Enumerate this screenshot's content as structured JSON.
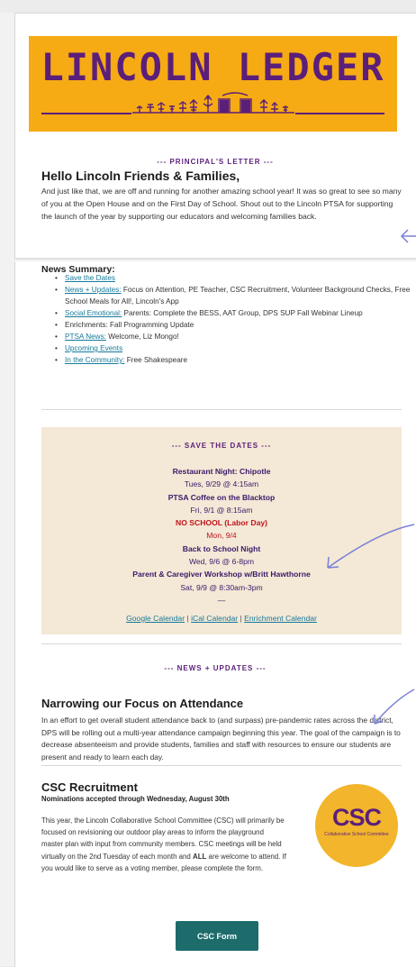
{
  "banner": {
    "title": "LINCOLN LEDGER"
  },
  "principal": {
    "section_label": "--- PRINCIPAL'S LETTER ---",
    "greeting": "Hello Lincoln Friends & Families,",
    "body": "And just like that, we are off and running for another amazing school year! It was so great to see so many of you at the Open House and on the First Day of School. Shout out to the Lincoln PTSA for supporting the launch of the year by supporting our educators and welcoming families back."
  },
  "summary": {
    "title": "News Summary:",
    "items": [
      {
        "link": "Save the Dates",
        "text": ""
      },
      {
        "link": "News + Updates:",
        "text": " Focus on Attention, PE Teacher, CSC Recruitment, Volunteer Background Checks, Free School Meals for All!, Lincoln's App"
      },
      {
        "link": "Social Emotional:",
        "text": " Parents: Complete the BESS, AAT Group, DPS SUP Fall Webinar Lineup"
      },
      {
        "link": "",
        "text": "Enrichments: Fall Programming Update"
      },
      {
        "link": "PTSA News:",
        "text": " Welcome, Liz Mongo!"
      },
      {
        "link": "Upcoming Events",
        "text": ""
      },
      {
        "link": "In the Community:",
        "text": " Free Shakespeare"
      }
    ]
  },
  "save_dates": {
    "section_label": "--- SAVE THE DATES ---",
    "events": [
      {
        "title": "Restaurant Night: Chipotle",
        "date": "Tues, 9/29 @ 4:15am"
      },
      {
        "title": "PTSA Coffee on the Blacktop",
        "date": "Fri, 9/1 @ 8:15am"
      },
      {
        "title": "NO SCHOOL (Labor Day)",
        "date": "Mon, 9/4"
      },
      {
        "title": "Back to School Night",
        "date": "Wed, 9/6 @ 6-8pm"
      },
      {
        "title": "Parent & Caregiver Workshop w/Britt Hawthorne",
        "date": "Sat, 9/9 @ 8:30am-3pm"
      }
    ],
    "separator": "—",
    "calendars": [
      "Google Calendar",
      "iCal Calendar",
      "Enrichment Calendar"
    ],
    "cal_sep": " | "
  },
  "news": {
    "section_label": "--- NEWS + UPDATES ---",
    "attendance_title": "Narrowing our Focus on Attendance",
    "attendance_body": "In an effort to get overall student attendance back to (and surpass) pre-pandemic rates across the district, DPS will be rolling out a multi-year attendance campaign beginning this year. The goal of the campaign is to decrease absenteeism and provide students, families and staff with resources to ensure our students are present and ready to learn each day."
  },
  "csc": {
    "title": "CSC Recruitment",
    "subtitle": "Nominations accepted through Wednesday, August 30th",
    "body_a": "This year, the Lincoln Collaborative School Committee (CSC) will primarily be focused on revisioning our outdoor play areas to inform the playground master plan with input from community members. CSC meetings will be held virtually on the 2nd Tuesday of each month and ",
    "body_bold": "ALL",
    "body_b": " are welcome to attend. If you would like to serve as a voting member, please complete the form.",
    "logo_text": "CSC",
    "logo_sub": "Collaborative School Committee",
    "button_label": "CSC Form"
  },
  "colors": {
    "banner_bg": "#f6ab14",
    "purple": "#5b1f7a",
    "link": "#167a9a",
    "red": "#c0141b",
    "save_bg": "#f4e8d6",
    "button_bg": "#1d6b6b",
    "arrow": "#7a80d8"
  }
}
